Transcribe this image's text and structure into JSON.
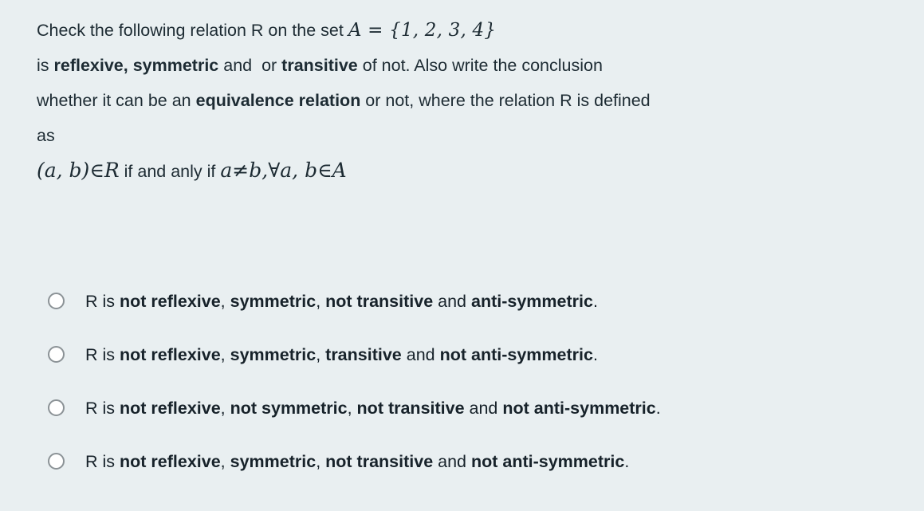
{
  "background_color": "#e9eff1",
  "question": {
    "lines": [
      {
        "id": "l1",
        "segments": [
          {
            "text": "Check the following relation R on the set ",
            "style": "normal"
          },
          {
            "text": "A = {1, 2, 3, 4}",
            "style": "math"
          }
        ]
      },
      {
        "id": "l2",
        "segments": [
          {
            "text": "is ",
            "style": "normal"
          },
          {
            "text": "reflexive, symmetric",
            "style": "bold"
          },
          {
            "text": " and  or ",
            "style": "normal"
          },
          {
            "text": "transitive",
            "style": "bold"
          },
          {
            "text": " of not. Also write the conclusion",
            "style": "normal"
          }
        ]
      },
      {
        "id": "l3",
        "segments": [
          {
            "text": "whether it can be an ",
            "style": "normal"
          },
          {
            "text": "equivalence relation",
            "style": "bold"
          },
          {
            "text": " or not, where the relation R is defined",
            "style": "normal"
          }
        ]
      },
      {
        "id": "l4",
        "segments": [
          {
            "text": "as",
            "style": "normal"
          }
        ]
      }
    ],
    "condition": {
      "pair": "(a, b)",
      "member_symbol": "∈",
      "relation_name": "R",
      "connector": "if and anly if",
      "a": "a",
      "not_equal_symbol": "≠",
      "b": "b",
      "comma": ",",
      "forall_symbol": "∀",
      "quantified": "a, b",
      "member_symbol_2": "∈",
      "set_name": "A"
    }
  },
  "answers": {
    "input_type": "radio",
    "selected_index": null,
    "options": [
      {
        "id": "option-1",
        "checked": false,
        "segments": [
          {
            "text": "R is ",
            "style": "normal"
          },
          {
            "text": "not reflexive",
            "style": "bold"
          },
          {
            "text": ", ",
            "style": "normal"
          },
          {
            "text": "symmetric",
            "style": "bold"
          },
          {
            "text": ", ",
            "style": "normal"
          },
          {
            "text": "not transitive",
            "style": "bold"
          },
          {
            "text": " and ",
            "style": "normal"
          },
          {
            "text": "anti-symmetric",
            "style": "bold"
          },
          {
            "text": ".",
            "style": "normal"
          }
        ]
      },
      {
        "id": "option-2",
        "checked": false,
        "segments": [
          {
            "text": "R is ",
            "style": "normal"
          },
          {
            "text": "not reflexive",
            "style": "bold"
          },
          {
            "text": ", ",
            "style": "normal"
          },
          {
            "text": "symmetric",
            "style": "bold"
          },
          {
            "text": ", ",
            "style": "normal"
          },
          {
            "text": "transitive",
            "style": "bold"
          },
          {
            "text": " and ",
            "style": "normal"
          },
          {
            "text": "not anti-symmetric",
            "style": "bold"
          },
          {
            "text": ".",
            "style": "normal"
          }
        ]
      },
      {
        "id": "option-3",
        "checked": false,
        "segments": [
          {
            "text": "R is ",
            "style": "normal"
          },
          {
            "text": "not reflexive",
            "style": "bold"
          },
          {
            "text": ", ",
            "style": "normal"
          },
          {
            "text": "not symmetric",
            "style": "bold"
          },
          {
            "text": ", ",
            "style": "normal"
          },
          {
            "text": "not transitive",
            "style": "bold"
          },
          {
            "text": " and ",
            "style": "normal"
          },
          {
            "text": "not anti-symmetric",
            "style": "bold"
          },
          {
            "text": ".",
            "style": "normal"
          }
        ]
      },
      {
        "id": "option-4",
        "checked": false,
        "segments": [
          {
            "text": "R is ",
            "style": "normal"
          },
          {
            "text": "not reflexive",
            "style": "bold"
          },
          {
            "text": ", ",
            "style": "normal"
          },
          {
            "text": "symmetric",
            "style": "bold"
          },
          {
            "text": ", ",
            "style": "normal"
          },
          {
            "text": "not transitive",
            "style": "bold"
          },
          {
            "text": " and ",
            "style": "normal"
          },
          {
            "text": "not anti-symmetric",
            "style": "bold"
          },
          {
            "text": ".",
            "style": "normal"
          }
        ]
      }
    ]
  }
}
